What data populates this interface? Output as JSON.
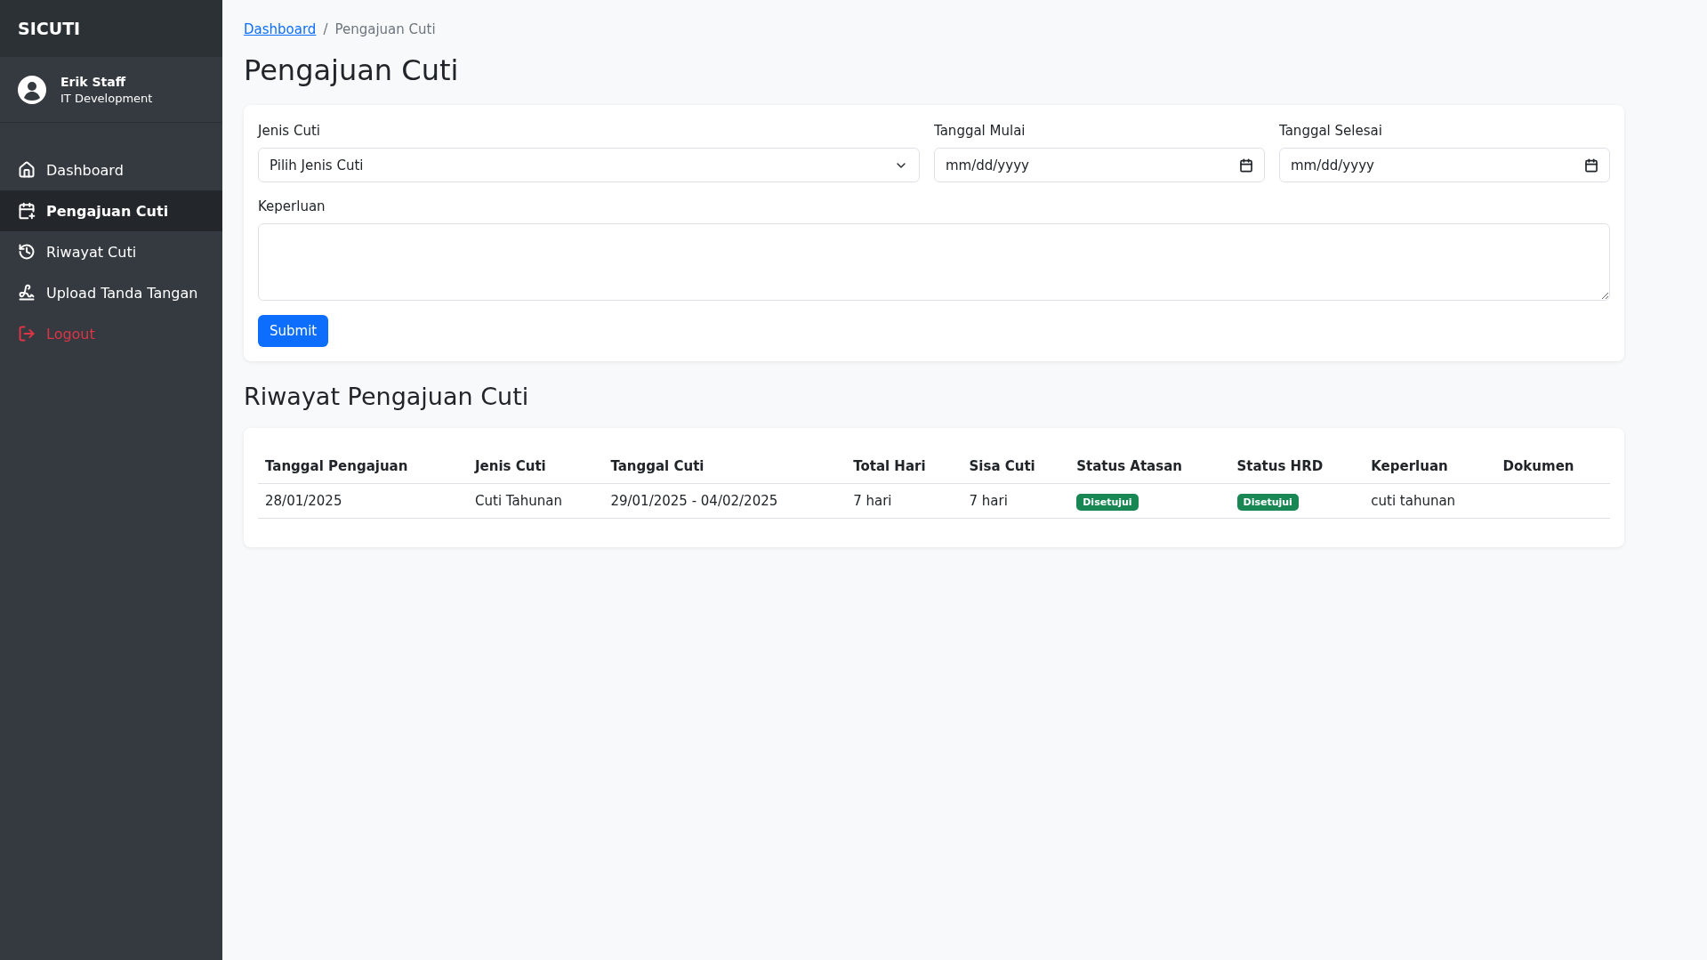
{
  "sidebar": {
    "brand": "SICUTI",
    "user": {
      "name": "Erik Staff",
      "department": "IT Development"
    },
    "items": [
      {
        "label": "Dashboard",
        "selected": false,
        "kind": "link"
      },
      {
        "label": "Pengajuan Cuti",
        "selected": true,
        "kind": "link"
      },
      {
        "label": "Riwayat Cuti",
        "selected": false,
        "kind": "link"
      },
      {
        "label": "Upload Tanda Tangan",
        "selected": false,
        "kind": "link"
      },
      {
        "label": "Logout",
        "selected": false,
        "kind": "danger"
      }
    ]
  },
  "breadcrumb": [
    {
      "label": "Dashboard",
      "kind": "link"
    },
    {
      "label": "/",
      "kind": "separator"
    },
    {
      "label": "Pengajuan Cuti",
      "kind": "current"
    }
  ],
  "page_title": "Pengajuan Cuti",
  "form": {
    "jenis_cuti": {
      "label": "Jenis Cuti",
      "value": "Pilih Jenis Cuti"
    },
    "tanggal_mulai": {
      "label": "Tanggal Mulai",
      "placeholder": "mm/dd/yyyy"
    },
    "tanggal_selesai": {
      "label": "Tanggal Selesai",
      "placeholder": "mm/dd/yyyy"
    },
    "keperluan": {
      "label": "Keperluan"
    },
    "submit": "Submit"
  },
  "history_title": "Riwayat Pengajuan Cuti",
  "table": {
    "columns": [
      "Tanggal Pengajuan",
      "Jenis Cuti",
      "Tanggal Cuti",
      "Total Hari",
      "Sisa Cuti",
      "Status Atasan",
      "Status HRD",
      "Keperluan",
      "Dokumen"
    ],
    "rows": [
      {
        "tanggal_pengajuan": "28/01/2025",
        "jenis_cuti": "Cuti Tahunan",
        "tanggal_cuti": "29/01/2025 - 04/02/2025",
        "total_hari": "7 hari",
        "sisa_cuti": "7 hari",
        "status_atasan": "Disetujui",
        "status_hrd": "Disetujui",
        "keperluan": "cuti tahunan"
      }
    ]
  }
}
